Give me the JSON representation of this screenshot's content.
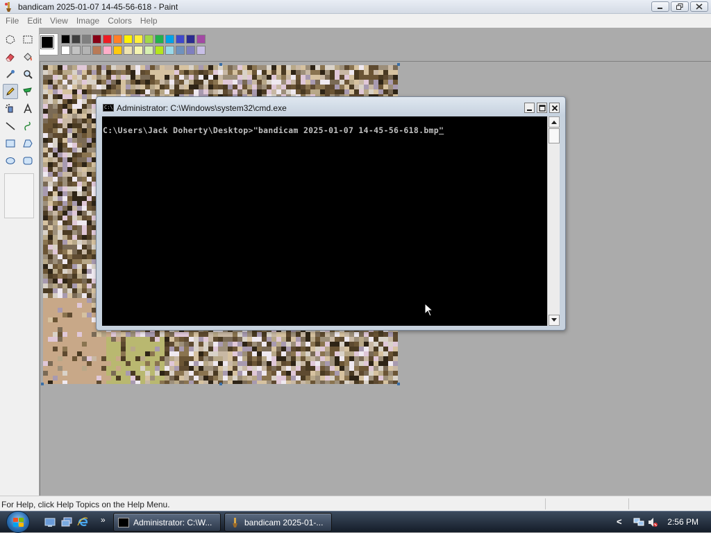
{
  "paint": {
    "title": "bandicam 2025-01-07 14-45-56-618 - Paint",
    "menu": [
      "File",
      "Edit",
      "View",
      "Image",
      "Colors",
      "Help"
    ],
    "palette": {
      "foreground": "#000000",
      "background": "#ffffff",
      "row1": [
        "#000000",
        "#3f3f3f",
        "#7f7f7f",
        "#880015",
        "#ed1c24",
        "#ff7f27",
        "#fff200",
        "#ffef3a",
        "#a3d848",
        "#22b14c",
        "#00a2e8",
        "#3f48cc",
        "#2b2b8f",
        "#a349a4"
      ],
      "row2": [
        "#ffffff",
        "#c3c3c3",
        "#b4b4b4",
        "#b97a57",
        "#ffaec9",
        "#ffc90e",
        "#efe4b0",
        "#f5f5b0",
        "#d7f0b0",
        "#b5e61d",
        "#99d9ea",
        "#7092be",
        "#7f7fbf",
        "#c8bfe7"
      ]
    },
    "status": "For Help, click Help Topics on the Help Menu."
  },
  "cmd": {
    "title": "Administrator: C:\\Windows\\system32\\cmd.exe",
    "prompt": "C:\\Users\\Jack Doherty\\Desktop>",
    "command": "\"bandicam 2025-01-07 14-45-56-618.bmp",
    "cursor_char": "\"",
    "icon_text": "C:\\"
  },
  "taskbar": {
    "buttons": [
      {
        "label": "Administrator: C:\\W..."
      },
      {
        "label": "bandicam 2025-01-..."
      }
    ],
    "overflow": "»",
    "tray_arrow": "<",
    "clock": "2:56 PM"
  }
}
